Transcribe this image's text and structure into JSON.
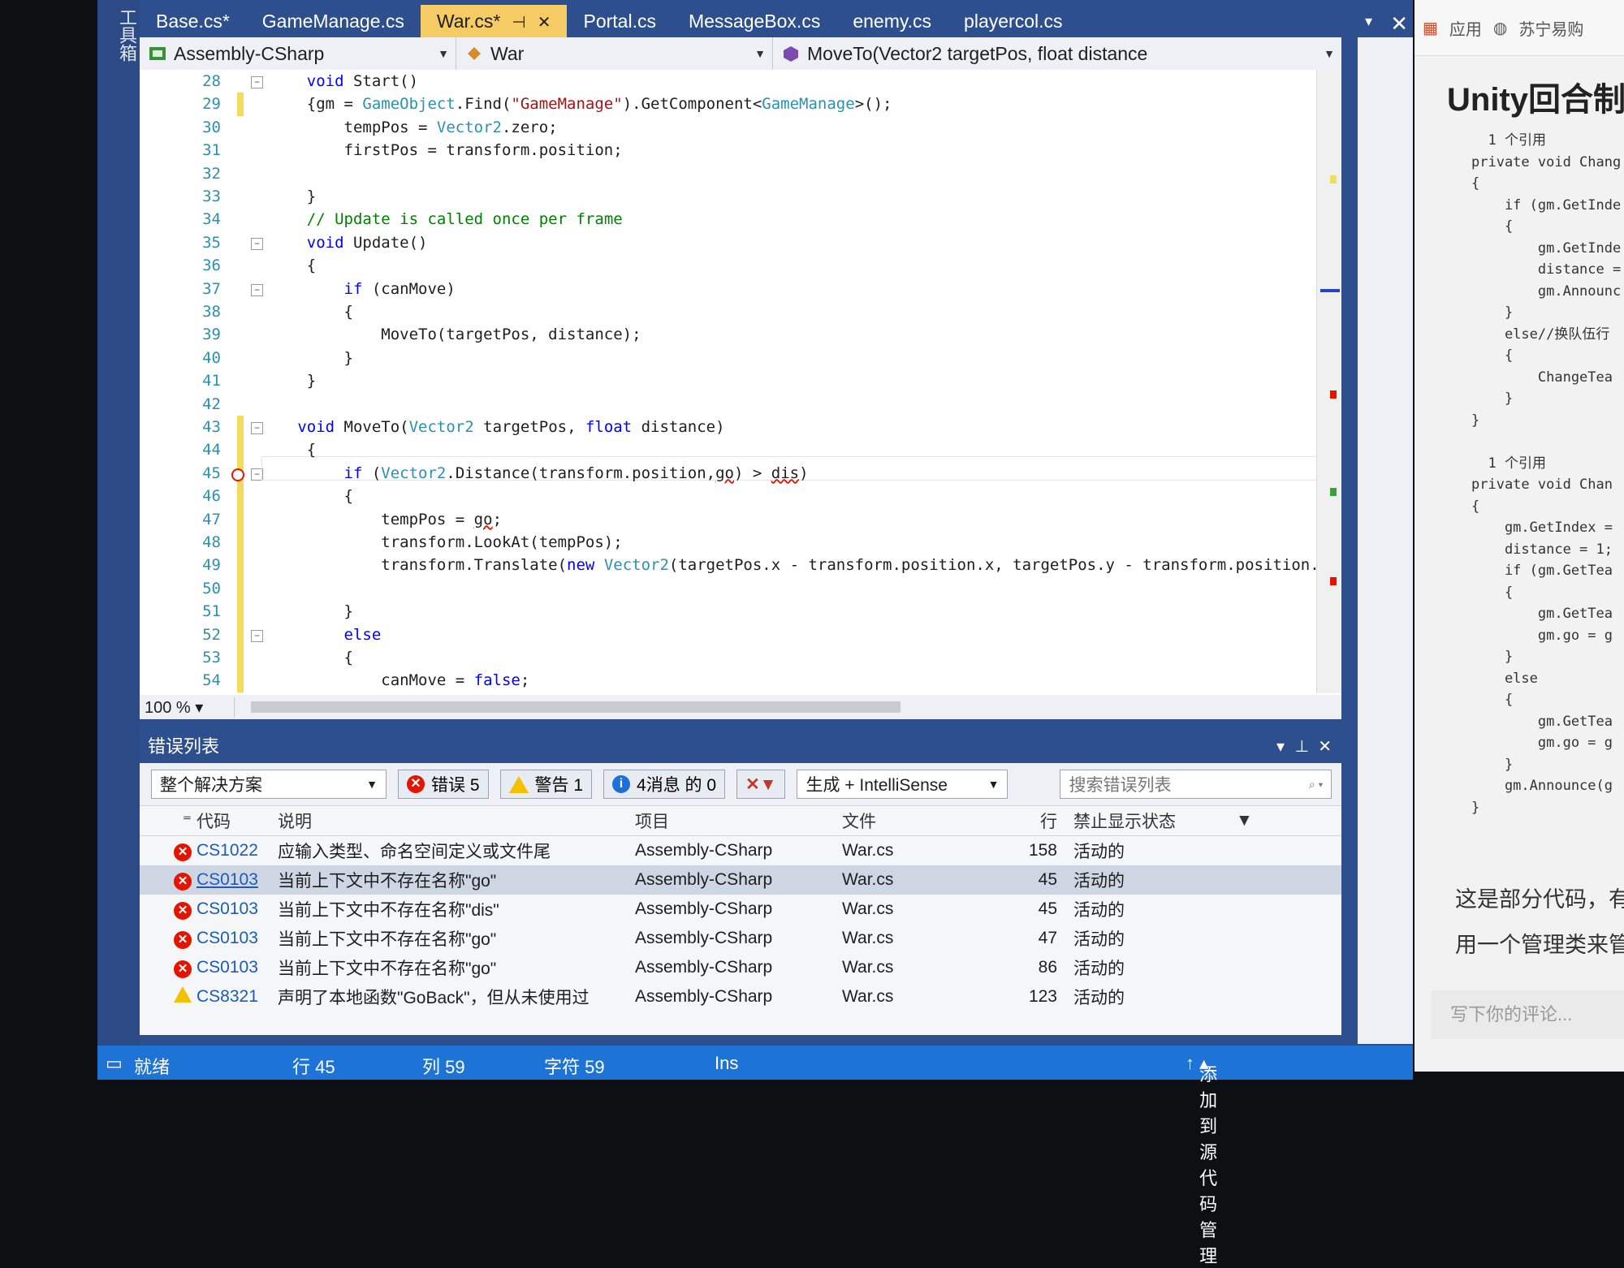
{
  "side_toolbox": {
    "label": "工具箱"
  },
  "tabs": [
    {
      "label": "Base.cs*",
      "active": false
    },
    {
      "label": "GameManage.cs",
      "active": false
    },
    {
      "label": "War.cs*",
      "active": true
    },
    {
      "label": "Portal.cs",
      "active": false
    },
    {
      "label": "MessageBox.cs",
      "active": false
    },
    {
      "label": "enemy.cs",
      "active": false
    },
    {
      "label": "playercol.cs",
      "active": false
    }
  ],
  "active_tab_pin": "⊣",
  "active_tab_close": "✕",
  "nav": {
    "project": "Assembly-CSharp",
    "class": "War",
    "member": "MoveTo(Vector2 targetPos, float distance"
  },
  "code_lines": [
    {
      "n": "28",
      "html": "    <span class='kw'>void</span> Start()"
    },
    {
      "n": "29",
      "html": "    {gm = <span class='ty'>GameObject</span>.Find(<span class='st'>\"GameManage\"</span>).GetComponent&lt;<span class='ty'>GameManage</span>&gt;();"
    },
    {
      "n": "30",
      "html": "        tempPos = <span class='ty'>Vector2</span>.zero;"
    },
    {
      "n": "31",
      "html": "        firstPos = transform.position;"
    },
    {
      "n": "32",
      "html": ""
    },
    {
      "n": "33",
      "html": "    }"
    },
    {
      "n": "34",
      "html": "    <span class='cm'>// Update is called once per frame</span>"
    },
    {
      "n": "35",
      "html": "    <span class='kw'>void</span> Update()"
    },
    {
      "n": "36",
      "html": "    {"
    },
    {
      "n": "37",
      "html": "        <span class='kw'>if</span> (canMove)"
    },
    {
      "n": "38",
      "html": "        {"
    },
    {
      "n": "39",
      "html": "            MoveTo(targetPos, distance);"
    },
    {
      "n": "40",
      "html": "        }"
    },
    {
      "n": "41",
      "html": "    }"
    },
    {
      "n": "42",
      "html": ""
    },
    {
      "n": "43",
      "html": "   <span class='kw'>void</span> MoveTo(<span class='ty'>Vector2</span> targetPos, <span class='kw'>float</span> distance)"
    },
    {
      "n": "44",
      "html": "    {"
    },
    {
      "n": "45",
      "html": "        <span class='kw'>if</span> (<span class='ty'>Vector2</span>.Distance(transform.position,<span class='err'>go</span>) &gt; <span class='err'>dis</span>)"
    },
    {
      "n": "46",
      "html": "        {"
    },
    {
      "n": "47",
      "html": "            tempPos = <span class='err'>go</span>;"
    },
    {
      "n": "48",
      "html": "            transform.LookAt(tempPos);"
    },
    {
      "n": "49",
      "html": "            transform.Translate(<span class='kw'>new</span> <span class='ty'>Vector2</span>(targetPos.x - transform.position.x, targetPos.y - transform.position.y"
    },
    {
      "n": "50",
      "html": ""
    },
    {
      "n": "51",
      "html": "        }"
    },
    {
      "n": "52",
      "html": "        <span class='kw'>else</span>"
    },
    {
      "n": "53",
      "html": "        {"
    },
    {
      "n": "54",
      "html": "            canMove = <span class='kw'>false</span>;"
    }
  ],
  "editor_footer": {
    "zoom": "100 %"
  },
  "error_list": {
    "title": "错误列表",
    "scope": "整个解决方案",
    "errors_btn": "错误 5",
    "warnings_btn": "警告 1",
    "messages_btn": "4消息 的 0",
    "build_filter": "生成 + IntelliSense",
    "search_placeholder": "搜索错误列表",
    "headers": {
      "code": "代码",
      "desc": "说明",
      "project": "项目",
      "file": "文件",
      "line": "行",
      "state": "禁止显示状态"
    },
    "rows": [
      {
        "type": "error",
        "code": "CS1022",
        "desc": "应输入类型、命名空间定义或文件尾",
        "project": "Assembly-CSharp",
        "file": "War.cs",
        "line": "158",
        "state": "活动的"
      },
      {
        "type": "error",
        "code": "CS0103",
        "desc": "当前上下文中不存在名称\"go\"",
        "project": "Assembly-CSharp",
        "file": "War.cs",
        "line": "45",
        "state": "活动的",
        "selected": true
      },
      {
        "type": "error",
        "code": "CS0103",
        "desc": "当前上下文中不存在名称\"dis\"",
        "project": "Assembly-CSharp",
        "file": "War.cs",
        "line": "45",
        "state": "活动的"
      },
      {
        "type": "error",
        "code": "CS0103",
        "desc": "当前上下文中不存在名称\"go\"",
        "project": "Assembly-CSharp",
        "file": "War.cs",
        "line": "47",
        "state": "活动的"
      },
      {
        "type": "error",
        "code": "CS0103",
        "desc": "当前上下文中不存在名称\"go\"",
        "project": "Assembly-CSharp",
        "file": "War.cs",
        "line": "86",
        "state": "活动的"
      },
      {
        "type": "warning",
        "code": "CS8321",
        "desc": "声明了本地函数\"GoBack\"，但从未使用过",
        "project": "Assembly-CSharp",
        "file": "War.cs",
        "line": "123",
        "state": "活动的"
      }
    ]
  },
  "status_bar": {
    "ready": "就绪",
    "row": "行 45",
    "col": "列 59",
    "char": "字符 59",
    "ins": "Ins",
    "source_control": "添加到源代码管理"
  },
  "browser": {
    "bookmark_apps": "应用",
    "bookmark_suning": "苏宁易购",
    "article_title": "Unity回合制",
    "article_code": "  1 个引用\nprivate void Chang\n{\n    if (gm.GetInde\n    {\n        gm.GetInde\n        distance =\n        gm.Announc\n    }\n    else//换队伍行\n    {\n        ChangeTea\n    }\n}\n\n  1 个引用\nprivate void Chan\n{\n    gm.GetIndex =\n    distance = 1;\n    if (gm.GetTea\n    {\n        gm.GetTea\n        gm.go = g\n    }\n    else\n    {\n        gm.GetTea\n        gm.go = g\n    }\n    gm.Announce(g\n}",
    "article_text_1": "这是部分代码，有",
    "article_text_2": "用一个管理类来管",
    "comment_placeholder": "写下你的评论..."
  }
}
